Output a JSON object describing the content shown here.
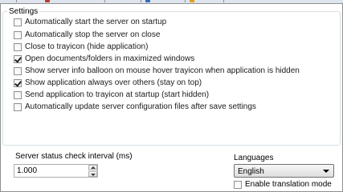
{
  "settings": {
    "group_title": "Settings",
    "options": [
      {
        "label": "Automatically start the server on startup",
        "checked": false
      },
      {
        "label": "Automatically stop the server on close",
        "checked": false
      },
      {
        "label": "Close to trayicon (hide application)",
        "checked": false
      },
      {
        "label": "Open documents/folders in maximized windows",
        "checked": true
      },
      {
        "label": "Show server info balloon on mouse hover trayicon when application is hidden",
        "checked": false
      },
      {
        "label": "Show application always over others (stay on top)",
        "checked": true
      },
      {
        "label": "Send application to trayicon at startup (start hidden)",
        "checked": false
      },
      {
        "label": "Automatically update server configuration files after save settings",
        "checked": false
      }
    ]
  },
  "status_check": {
    "label": "Server status check interval (ms)",
    "value": "1.000"
  },
  "languages": {
    "label": "Languages",
    "selected": "English",
    "enable_translation_label": "Enable translation mode",
    "enable_translation_checked": false
  }
}
